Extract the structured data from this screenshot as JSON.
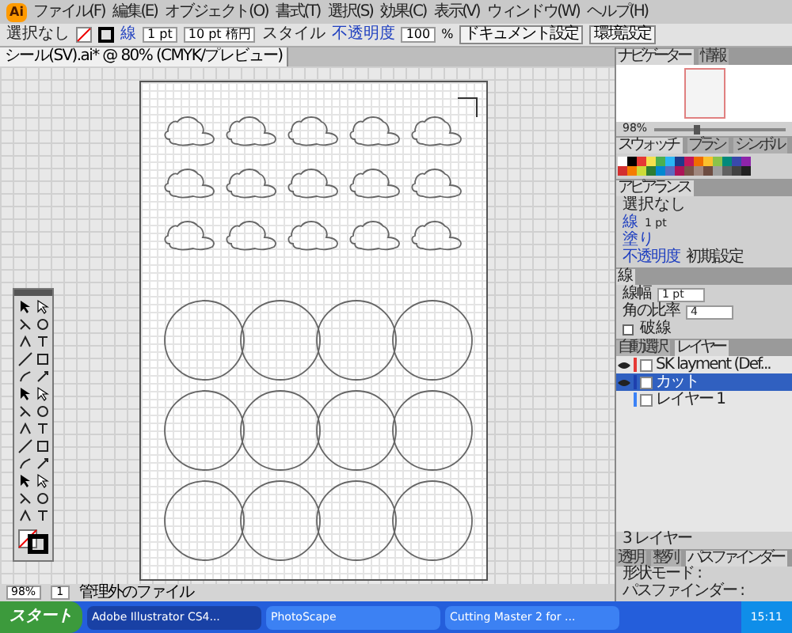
{
  "app_logo": "Ai",
  "menu": [
    "ファイル(F)",
    "編集(E)",
    "オブジェクト(O)",
    "書式(T)",
    "選択(S)",
    "効果(C)",
    "表示(V)",
    "ウィンドウ(W)",
    "ヘルプ(H)"
  ],
  "control_bar": {
    "selection": "選択なし",
    "stroke_label": "線",
    "stroke_weight": "1 pt",
    "brush": "10 pt 楕円",
    "style_label": "スタイル",
    "opacity_label": "不透明度",
    "opacity": "100",
    "percent": "%",
    "buttons": [
      "ドキュメント設定",
      "環境設定"
    ]
  },
  "doc_tabs": [
    {
      "label": "シール(SV).ai* @ 80% (CMYK/プレビュー)",
      "selected": true
    }
  ],
  "navigator": {
    "tabs": [
      {
        "label": "ナビゲーター",
        "selected": true
      },
      {
        "label": "情報",
        "selected": false
      }
    ],
    "zoom": "98%",
    "zoom_slider": {
      "level": 0.3
    }
  },
  "swatches": {
    "tabs": [
      {
        "label": "スウォッチ",
        "selected": true
      },
      {
        "label": "ブラシ",
        "selected": false
      },
      {
        "label": "シンボル",
        "selected": false
      }
    ],
    "items": [
      {
        "color": "#ffffff"
      },
      {
        "color": "#000000"
      },
      {
        "color": "#e53935"
      },
      {
        "color": "#f4e04d"
      },
      {
        "color": "#4caf50"
      },
      {
        "color": "#29b6f6"
      },
      {
        "color": "#1e3a8a"
      },
      {
        "color": "#c2185b"
      },
      {
        "color": "#ef6c00"
      },
      {
        "color": "#fbc02d"
      },
      {
        "color": "#8bc34a"
      },
      {
        "color": "#00897b"
      },
      {
        "color": "#3949ab"
      },
      {
        "color": "#8e24aa"
      },
      {
        "color": "#d32f2f"
      },
      {
        "color": "#f57c00"
      },
      {
        "color": "#cddc39"
      },
      {
        "color": "#2e7d32"
      },
      {
        "color": "#0288d1"
      },
      {
        "color": "#5c6bc0"
      },
      {
        "color": "#ad1457"
      },
      {
        "color": "#795548"
      },
      {
        "color": "#a1887f"
      },
      {
        "color": "#6d4c41"
      },
      {
        "color": "#9e9e9e"
      },
      {
        "color": "#616161"
      },
      {
        "color": "#424242"
      },
      {
        "color": "#212121"
      }
    ]
  },
  "appearance": {
    "tab": "アピアランス",
    "title": "選択なし",
    "rows": [
      {
        "label": "線",
        "value": "1 pt"
      },
      {
        "label": "塗り",
        "value": ""
      }
    ],
    "opacity_label": "不透明度",
    "opacity_value": "初期設定"
  },
  "stroke_panel": {
    "tab": "線",
    "weight_label": "線幅",
    "weight": "1 pt",
    "miter_label": "角の比率",
    "miter": "4",
    "dashed_label": "破線",
    "dashed": false
  },
  "layers": {
    "tabs": [
      {
        "label": "自動選択",
        "selected": false
      },
      {
        "label": "レイヤー",
        "selected": true
      }
    ],
    "items": [
      {
        "name": "SK layment (Def...",
        "color": "#e53935",
        "selected": false,
        "visible": true
      },
      {
        "name": "カット",
        "color": "#1e40af",
        "selected": true,
        "visible": true
      },
      {
        "name": "レイヤー 1",
        "color": "#3b82f6",
        "selected": false,
        "visible": false
      }
    ],
    "count": "3 レイヤー"
  },
  "pathfinder": {
    "tabs": [
      {
        "label": "透明",
        "selected": false
      },
      {
        "label": "整列",
        "selected": false
      },
      {
        "label": "パスファインダー",
        "selected": true
      }
    ],
    "shape_modes": "形状モード :",
    "pathfinders": "パスファインダー :"
  },
  "status_bar": {
    "zoom": "98%",
    "artboard": "1",
    "info": "管理外のファイル"
  },
  "taskbar": {
    "start": "スタート",
    "tasks": [
      {
        "label": "Adobe Illustrator CS4...",
        "selected": true
      },
      {
        "label": "PhotoScape",
        "selected": false
      },
      {
        "label": "Cutting Master 2 for ...",
        "selected": false
      }
    ],
    "clock": "15:11"
  }
}
